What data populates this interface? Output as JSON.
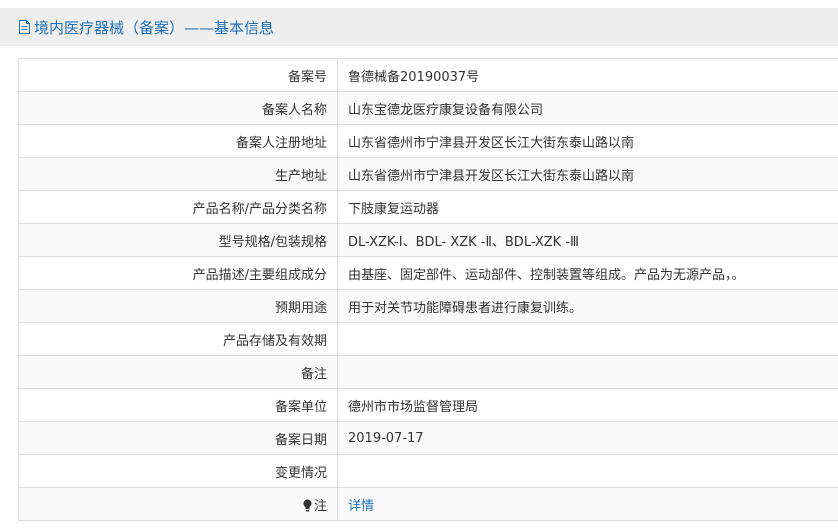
{
  "header": {
    "title": "境内医疗器械（备案）——基本信息",
    "icon": "document-icon"
  },
  "rows": [
    {
      "label": "备案号",
      "value": "鲁德械备20190037号"
    },
    {
      "label": "备案人名称",
      "value": "山东宝德龙医疗康复设备有限公司"
    },
    {
      "label": "备案人注册地址",
      "value": "山东省德州市宁津县开发区长江大街东泰山路以南"
    },
    {
      "label": "生产地址",
      "value": "山东省德州市宁津县开发区长江大街东泰山路以南"
    },
    {
      "label": "产品名称/产品分类名称",
      "value": "下肢康复运动器"
    },
    {
      "label": "型号规格/包装规格",
      "value": "DL-XZK-Ⅰ、BDL- XZK -Ⅱ、BDL-XZK -Ⅲ"
    },
    {
      "label": "产品描述/主要组成成分",
      "value": "由基座、固定部件、运动部件、控制装置等组成。产品为无源产品，。"
    },
    {
      "label": "预期用途",
      "value": "用于对关节功能障碍患者进行康复训练。"
    },
    {
      "label": "产品存储及有效期",
      "value": ""
    },
    {
      "label": "备注",
      "value": ""
    },
    {
      "label": "备案单位",
      "value": "德州市市场监督管理局"
    },
    {
      "label": "备案日期",
      "value": "2019-07-17"
    },
    {
      "label": "变更情况",
      "value": ""
    }
  ],
  "note": {
    "label": "注",
    "icon": "lightbulb-icon",
    "link_text": "详情"
  },
  "colors": {
    "accent": "#1f72b8",
    "header_bg": "#eeeeee",
    "row_alt_bg": "#f9f9f9",
    "border": "#dddddd"
  }
}
